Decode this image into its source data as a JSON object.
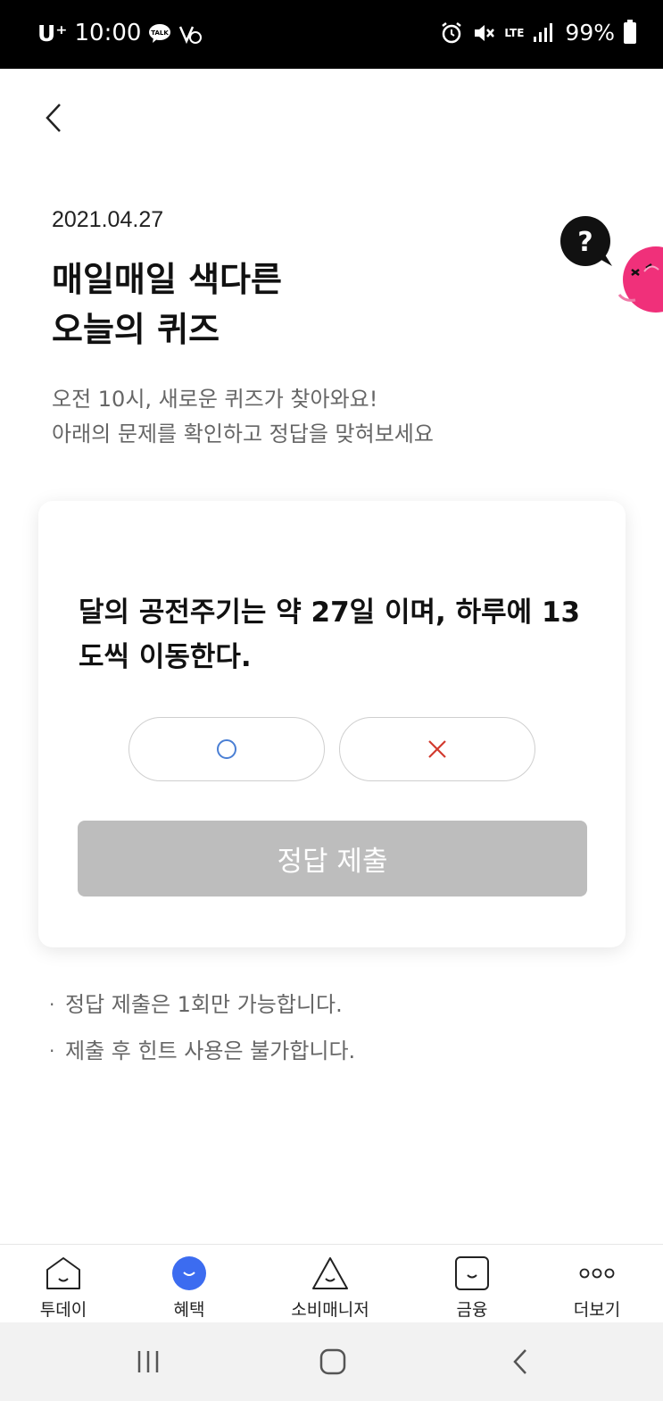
{
  "status_bar": {
    "carrier": "U⁺",
    "time": "10:00",
    "talk_badge": "TALK",
    "network": "LTE",
    "battery": "99%"
  },
  "header": {
    "date": "2021.04.27",
    "title_line1": "매일매일 색다른",
    "title_line2": "오늘의 퀴즈",
    "subtitle_line1": "오전 10시, 새로운 퀴즈가 찾아와요!",
    "subtitle_line2": "아래의 문제를 확인하고 정답을 맞혀보세요"
  },
  "quiz": {
    "question": "달의 공전주기는 약 27일 이며, 하루에 13 도씩 이동한다.",
    "option_o": "O",
    "option_x": "X",
    "submit_label": "정답 제출"
  },
  "notes": [
    "정답 제출은 1회만 가능합니다.",
    "제출 후 힌트 사용은 불가합니다."
  ],
  "bottom_nav": {
    "items": [
      {
        "label": "투데이",
        "icon": "home-face-icon",
        "active": false
      },
      {
        "label": "혜택",
        "icon": "benefit-face-icon",
        "active": true
      },
      {
        "label": "소비매니저",
        "icon": "triangle-face-icon",
        "active": false
      },
      {
        "label": "금융",
        "icon": "square-face-icon",
        "active": false
      },
      {
        "label": "더보기",
        "icon": "more-dots-icon",
        "active": false
      }
    ]
  },
  "colors": {
    "accent_blue": "#3c6cf0",
    "o_blue": "#4a7fd4",
    "x_red": "#d23a2e",
    "submit_disabled": "#bdbdbd",
    "character_pink": "#f0307a"
  }
}
